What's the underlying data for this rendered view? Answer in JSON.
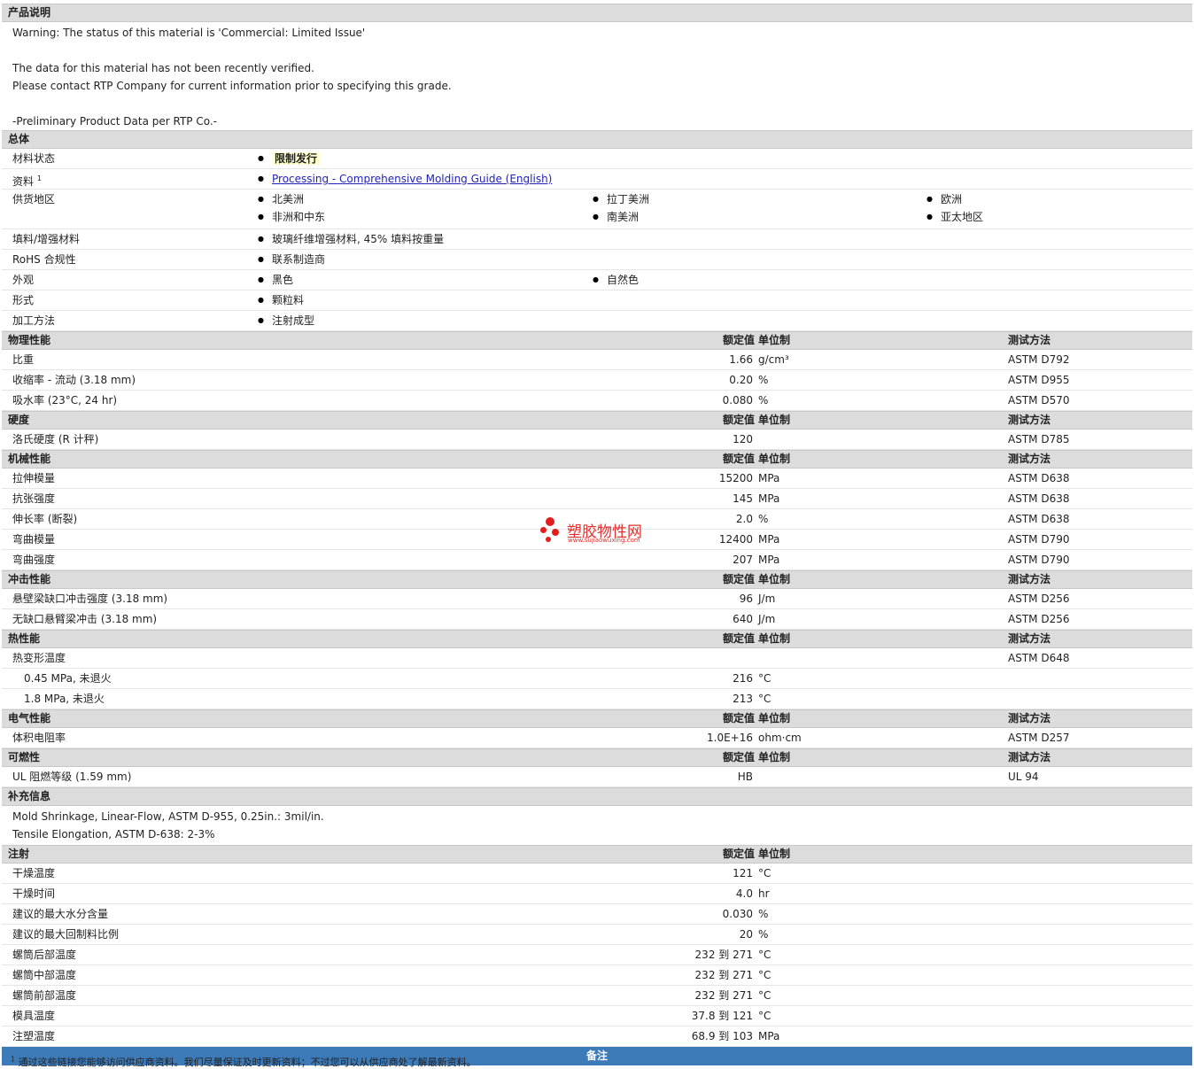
{
  "sections": {
    "desc": "产品说明",
    "general": "总体",
    "physical": "物理性能",
    "hardness": "硬度",
    "mechanical": "机械性能",
    "impact": "冲击性能",
    "thermal": "热性能",
    "electrical": "电气性能",
    "flammability": "可燃性",
    "supplemental": "补充信息",
    "injection": "注射",
    "remarks": "备注"
  },
  "headers": {
    "value": "额定值",
    "unit": "单位制",
    "method": "测试方法"
  },
  "description": [
    "Warning: The status of this material is 'Commercial: Limited Issue'",
    "",
    "The data for this material has not been recently verified.",
    "Please contact RTP Company for current information prior to specifying this grade.",
    "",
    "-Preliminary Product Data per RTP Co.-"
  ],
  "general": {
    "status_label": "材料状态",
    "status_value": "限制发行",
    "docs_label": "资料",
    "docs_sup": "1",
    "docs_link": "Processing - Comprehensive Molding Guide (English)",
    "regions_label": "供货地区",
    "regions": [
      "北美洲",
      "拉丁美洲",
      "欧洲",
      "非洲和中东",
      "南美洲",
      "亚太地区"
    ],
    "filler_label": "填料/增强材料",
    "filler_value": "玻璃纤维增强材料, 45% 填料按重量",
    "rohs_label": "RoHS 合规性",
    "rohs_value": "联系制造商",
    "appearance_label": "外观",
    "appearance": [
      "黑色",
      "自然色"
    ],
    "form_label": "形式",
    "form_value": "颗粒料",
    "process_label": "加工方法",
    "process_value": "注射成型"
  },
  "physical": [
    {
      "label": "比重",
      "value": "1.66",
      "unit": "g/cm³",
      "method": "ASTM D792"
    },
    {
      "label": "收缩率 - 流动 (3.18 mm)",
      "value": "0.20",
      "unit": "%",
      "method": "ASTM D955"
    },
    {
      "label": "吸水率 (23°C, 24 hr)",
      "value": "0.080",
      "unit": "%",
      "method": "ASTM D570"
    }
  ],
  "hardness": [
    {
      "label": "洛氏硬度 (R 计秤)",
      "value": "120",
      "unit": "",
      "method": "ASTM D785"
    }
  ],
  "mechanical": [
    {
      "label": "拉伸模量",
      "value": "15200",
      "unit": "MPa",
      "method": "ASTM D638"
    },
    {
      "label": "抗张强度",
      "value": "145",
      "unit": "MPa",
      "method": "ASTM D638"
    },
    {
      "label": "伸长率 (断裂)",
      "value": "2.0",
      "unit": "%",
      "method": "ASTM D638"
    },
    {
      "label": "弯曲模量",
      "value": "12400",
      "unit": "MPa",
      "method": "ASTM D790"
    },
    {
      "label": "弯曲强度",
      "value": "207",
      "unit": "MPa",
      "method": "ASTM D790"
    }
  ],
  "impact": [
    {
      "label": "悬壁梁缺口冲击强度 (3.18 mm)",
      "value": "96",
      "unit": "J/m",
      "method": "ASTM D256"
    },
    {
      "label": "无缺口悬臂梁冲击 (3.18 mm)",
      "value": "640",
      "unit": "J/m",
      "method": "ASTM D256"
    }
  ],
  "thermal": [
    {
      "label": "热变形温度",
      "value": "",
      "unit": "",
      "method": "ASTM D648"
    },
    {
      "label": "0.45 MPa, 未退火",
      "value": "216",
      "unit": "°C",
      "method": ""
    },
    {
      "label": "1.8 MPa, 未退火",
      "value": "213",
      "unit": "°C",
      "method": ""
    }
  ],
  "electrical": [
    {
      "label": "体积电阻率",
      "value": "1.0E+16",
      "unit": "ohm·cm",
      "method": "ASTM D257"
    }
  ],
  "flammability": [
    {
      "label": "UL 阻燃等级 (1.59 mm)",
      "value": "HB",
      "unit": "",
      "method": "UL 94"
    }
  ],
  "supplemental": [
    "Mold Shrinkage, Linear-Flow, ASTM D-955, 0.25in.: 3mil/in.",
    "Tensile Elongation, ASTM D-638: 2-3%"
  ],
  "injection": [
    {
      "label": "干燥温度",
      "value": "121",
      "unit": "°C"
    },
    {
      "label": "干燥时间",
      "value": "4.0",
      "unit": "hr"
    },
    {
      "label": "建议的最大水分含量",
      "value": "0.030",
      "unit": "%"
    },
    {
      "label": "建议的最大回制料比例",
      "value": "20",
      "unit": "%"
    },
    {
      "label": "螺筒后部温度",
      "value": "232 到  271",
      "unit": "°C"
    },
    {
      "label": "螺筒中部温度",
      "value": "232 到  271",
      "unit": "°C"
    },
    {
      "label": "螺筒前部温度",
      "value": "232 到  271",
      "unit": "°C"
    },
    {
      "label": "模具温度",
      "value": "37.8 到  121",
      "unit": "°C"
    },
    {
      "label": "注塑温度",
      "value": "68.9 到  103",
      "unit": "MPa"
    }
  ],
  "watermark": {
    "name": "塑胶物性网",
    "url": "www.sujiaowuxing.com"
  },
  "footnote": {
    "sup": "1",
    "text": "通过这些链接您能够访问供应商资料。我们尽量保证及时更新资料；不过您可以从供应商处了解最新资料。"
  }
}
